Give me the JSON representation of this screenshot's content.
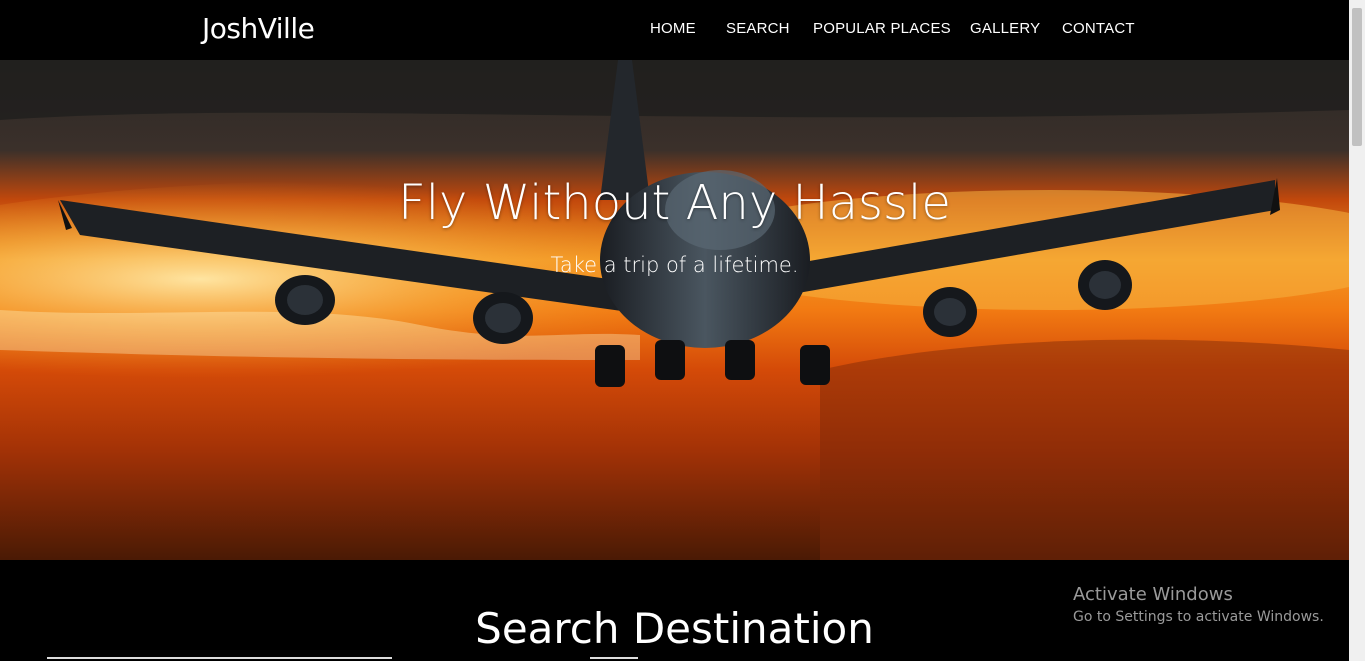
{
  "navbar": {
    "brand": "JoshVille",
    "items": [
      "HOME",
      "SEARCH",
      "POPULAR PLACES",
      "GALLERY",
      "CONTACT"
    ]
  },
  "hero": {
    "title": "Fly Without Any Hassle",
    "subtitle": "Take a trip of a lifetime."
  },
  "search_section": {
    "title": "Search Destination"
  },
  "watermark": {
    "line1": "Activate Windows",
    "line2": "Go to Settings to activate Windows."
  },
  "colors": {
    "navbar_bg": "#000000",
    "sky_orange": "#e8550e",
    "sky_yellow": "#f9c54a",
    "text": "#ffffff"
  }
}
